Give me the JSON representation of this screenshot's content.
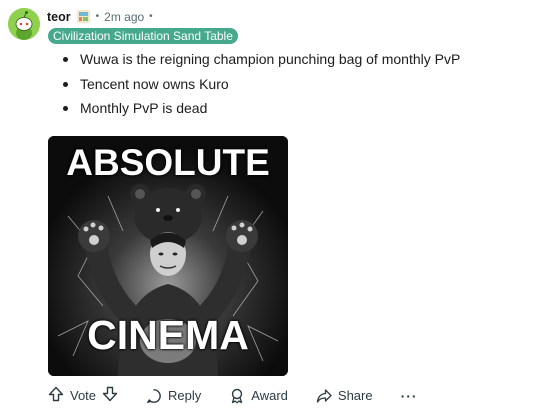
{
  "comment": {
    "username": "teor",
    "separator": "•",
    "time": "2m ago",
    "flair": "Civilization Simulation Sand Table",
    "bullets": [
      "Wuwa is the reigning champion punching bag of monthly PvP",
      "Tencent now owns Kuro",
      "Monthly PvP is dead"
    ],
    "image": {
      "top_text": "ABSOLUTE",
      "bottom_text": "CINEMA"
    }
  },
  "actions": {
    "vote": "Vote",
    "reply": "Reply",
    "award": "Award",
    "share": "Share",
    "more": "···"
  },
  "colors": {
    "flair_bg": "#46a98c",
    "avatar_bg": "#8fd14f",
    "meta_text": "#576f76"
  }
}
